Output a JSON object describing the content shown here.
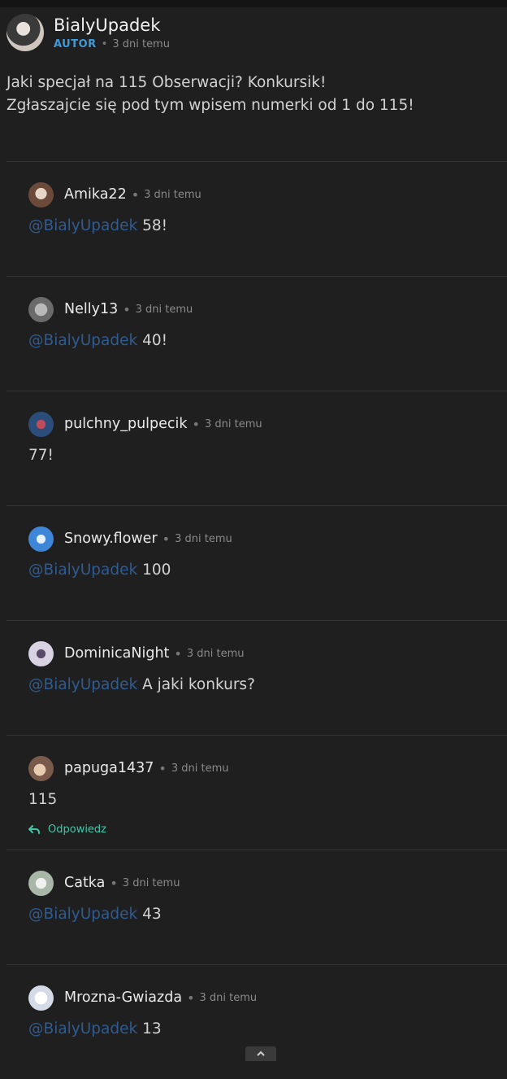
{
  "post": {
    "author": "BialyUpadek",
    "badge": "AUTOR",
    "time": "3 dni temu",
    "lines": [
      "Jaki specjał na 115 Obserwacji? Konkursik!",
      "Zgłaszajcie się pod tym wpisem numerki od 1 do 115!"
    ]
  },
  "comments": [
    {
      "user": "Amika22",
      "time": "3 dni temu",
      "mention": "@BialyUpadek",
      "text": "58!",
      "avatar_color": "#8a6b5a"
    },
    {
      "user": "Nelly13",
      "time": "3 dni temu",
      "mention": "@BialyUpadek",
      "text": "40!",
      "avatar_color": "#9a9a9a"
    },
    {
      "user": "pulchny_pulpecik",
      "time": "3 dni temu",
      "mention": "",
      "text": "77!",
      "avatar_color": "#3a5a8a"
    },
    {
      "user": "Snowy.flower",
      "time": "3 dni temu",
      "mention": "@BialyUpadek",
      "text": "100",
      "avatar_color": "#4a8ad0"
    },
    {
      "user": "DominicaNight",
      "time": "3 dni temu",
      "mention": "@BialyUpadek",
      "text": "A jaki konkurs?",
      "avatar_color": "#c9c2d3"
    },
    {
      "user": "papuga1437",
      "time": "3 dni temu",
      "mention": "",
      "text": "115",
      "avatar_color": "#b89a7a",
      "reply_label": "Odpowiedz"
    },
    {
      "user": "Catka",
      "time": "3 dni temu",
      "mention": "@BialyUpadek",
      "text": "43",
      "avatar_color": "#cfcfcf"
    },
    {
      "user": "Mrozna-Gwiazda",
      "time": "3 dni temu",
      "mention": "@BialyUpadek",
      "text": "13",
      "avatar_color": "#dfe3ea"
    }
  ],
  "icons": {
    "reply": "reply-arrow-icon",
    "scroll_top": "chevron-up-icon"
  },
  "colors": {
    "mention": "#2f5b91",
    "badge": "#3f9ad9",
    "reply": "#3fc7a8",
    "background": "#1f1f1f"
  }
}
